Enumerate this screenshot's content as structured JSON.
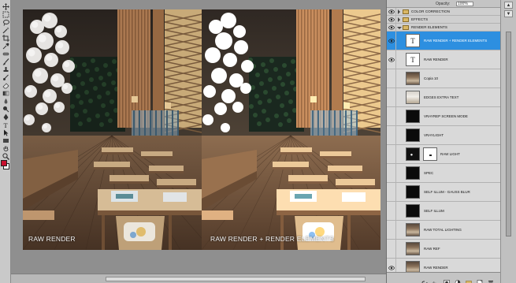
{
  "toolbar": {
    "tools": [
      "move-tool-icon",
      "marquee-tool-icon",
      "lasso-tool-icon",
      "magic-wand-icon",
      "crop-tool-icon",
      "eyedropper-icon",
      "healing-brush-icon",
      "brush-tool-icon",
      "clone-stamp-icon",
      "history-brush-icon",
      "eraser-icon",
      "gradient-icon",
      "blur-tool-icon",
      "dodge-tool-icon",
      "pen-tool-icon",
      "type-tool-icon",
      "path-select-icon",
      "shape-tool-icon",
      "hand-tool-icon",
      "zoom-tool-icon"
    ],
    "foreground_color": "#c8102e",
    "background_color": "#ffffff"
  },
  "document": {
    "left_caption": "RAW RENDER",
    "right_caption": "RAW RENDER + RENDER ELEMENTS"
  },
  "status_bar": {
    "zoom": "",
    "doc_info": ""
  },
  "layers_panel": {
    "opacity_label": "Opacity:",
    "opacity_value": "100%",
    "groups": [
      {
        "name": "COLOR CORRECTION",
        "open": false
      },
      {
        "name": "EFFECTS",
        "open": false
      },
      {
        "name": "RENDER ELEMENTS",
        "open": true
      }
    ],
    "layers": [
      {
        "name": "RAW RENDER + RENDER ELEMENTS",
        "thumb": "text",
        "selected": true,
        "visible": true
      },
      {
        "name": "RAW RENDER",
        "thumb": "text",
        "selected": false,
        "visible": true
      },
      {
        "name": "Copia 10",
        "thumb": "photo",
        "selected": false,
        "visible": false
      },
      {
        "name": "EDGES EXTRA TEXT",
        "thumb": "photo-light",
        "selected": false,
        "visible": false
      },
      {
        "name": "VRAYREP SCREEN MODE",
        "thumb": "dark",
        "selected": false,
        "visible": false
      },
      {
        "name": "VRAYLIGHT",
        "thumb": "dark",
        "selected": false,
        "visible": false
      },
      {
        "name": "RAW LIGHT",
        "thumb": "dark-spot",
        "selected": false,
        "visible": false,
        "mask": true
      },
      {
        "name": "SPEC",
        "thumb": "dark",
        "selected": false,
        "visible": false
      },
      {
        "name": "SELF ILLUM - GAUSS BLUR",
        "thumb": "dark",
        "selected": false,
        "visible": false
      },
      {
        "name": "SELF ILLUM",
        "thumb": "dark",
        "selected": false,
        "visible": false
      },
      {
        "name": "RAW TOTAL LIGHTING",
        "thumb": "photo",
        "selected": false,
        "visible": false
      },
      {
        "name": "RAW REF",
        "thumb": "photo",
        "selected": false,
        "visible": false
      },
      {
        "name": "RAW RENDER",
        "thumb": "photo",
        "selected": false,
        "visible": true
      }
    ],
    "bottom_icons": [
      "link-icon",
      "fx-icon",
      "mask-icon",
      "adjustment-icon",
      "folder-icon",
      "new-layer-icon",
      "trash-icon"
    ]
  }
}
